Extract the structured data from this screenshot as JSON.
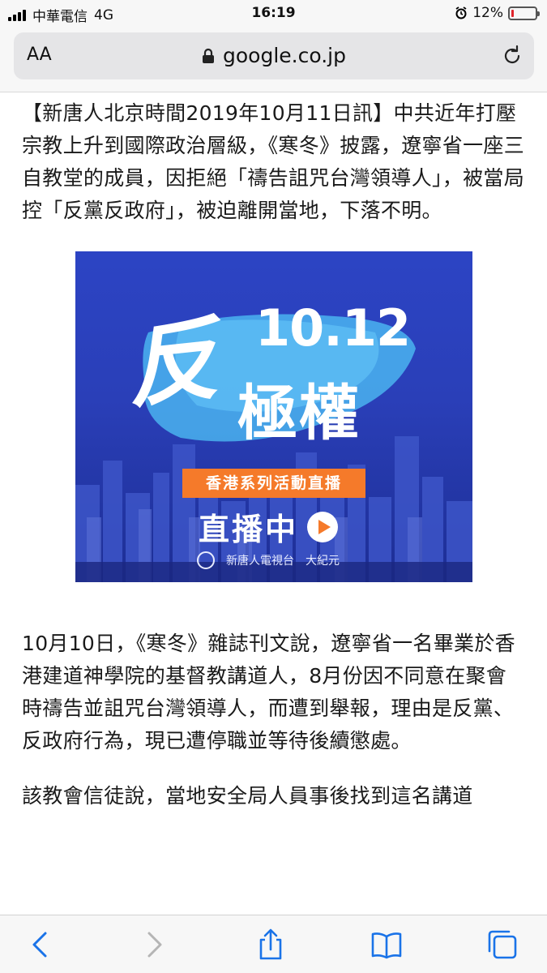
{
  "status_bar": {
    "carrier": "中華電信",
    "network": "4G",
    "time": "16:19",
    "battery_percent": "12%",
    "battery_level": 0.12
  },
  "address_bar": {
    "text_size_label": "AA",
    "url": "google.co.jp"
  },
  "article": {
    "paragraph_1": "【新唐人北京時間2019年10月11日訊】中共近年打壓宗教上升到國際政治層級，《寒冬》披露，遼寧省一座三自教堂的成員，因拒絕「禱告詛咒台灣領導人」，被當局控「反黨反政府」，被迫離開當地，下落不明。",
    "paragraph_2": "10月10日，《寒冬》雜誌刊文說，遼寧省一名畢業於香港建道神學院的基督教講道人，8月份因不同意在聚會時禱告並詛咒台灣領導人，而遭到舉報，理由是反黨、反政府行為，現已遭停職並等待後續懲處。",
    "paragraph_3": "該教會信徒說，當地安全局人員事後找到這名講道"
  },
  "banner": {
    "big_char": "反",
    "date": "10.12",
    "subtitle": "極權",
    "pill": "香港系列活動直播",
    "live": "直播中",
    "logo_1": "新唐人電視台",
    "logo_2": "大紀元"
  },
  "colors": {
    "banner_blue": "#2a3fb8",
    "pill_orange": "#f57a2a",
    "safari_blue": "#1a73e8",
    "battery_red": "#e0242b"
  },
  "toolbar": {
    "icons": [
      "back-icon",
      "forward-icon",
      "share-icon",
      "bookmarks-icon",
      "tabs-icon"
    ]
  }
}
